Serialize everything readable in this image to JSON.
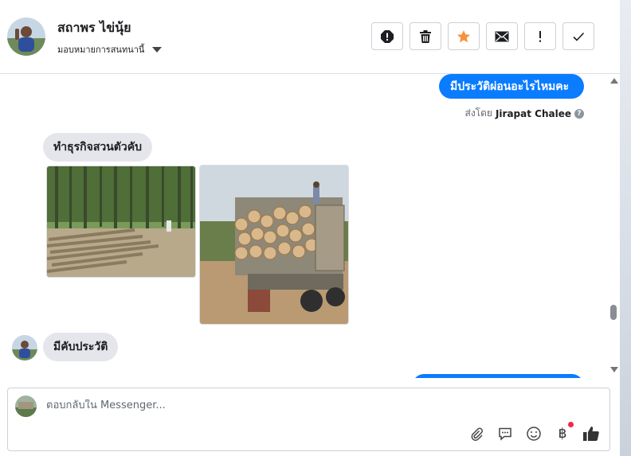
{
  "header": {
    "contact_name": "สถาพร ไข่นุ้ย",
    "assign_label": "มอบหมายการสนทนานี้",
    "actions": [
      {
        "name": "spam-button",
        "icon": "alert-circle-icon"
      },
      {
        "name": "delete-button",
        "icon": "trash-icon"
      },
      {
        "name": "star-button",
        "icon": "star-icon"
      },
      {
        "name": "mark-unread-button",
        "icon": "envelope-icon"
      },
      {
        "name": "follow-up-button",
        "icon": "exclamation-icon"
      },
      {
        "name": "mark-done-button",
        "icon": "checkmark-icon"
      }
    ],
    "star_color": "#f7923a"
  },
  "thread": {
    "outgoing_top": "มีประวัติผ่อนอะไรไหมคะ",
    "sent_by_prefix": "ส่งโดย",
    "sent_by_name": "Jirapat Chalee",
    "incoming_1": "ทำธุรกิจสวนตัวคับ",
    "incoming_2": "มีคับประวัติ",
    "outgoing_color": "#0a7cff"
  },
  "composer": {
    "placeholder": "ตอบกลับใน Messenger...",
    "tools": [
      "paperclip-icon",
      "message-bubble-icon",
      "smiley-icon",
      "baht-icon",
      "thumbs-up-icon"
    ]
  }
}
